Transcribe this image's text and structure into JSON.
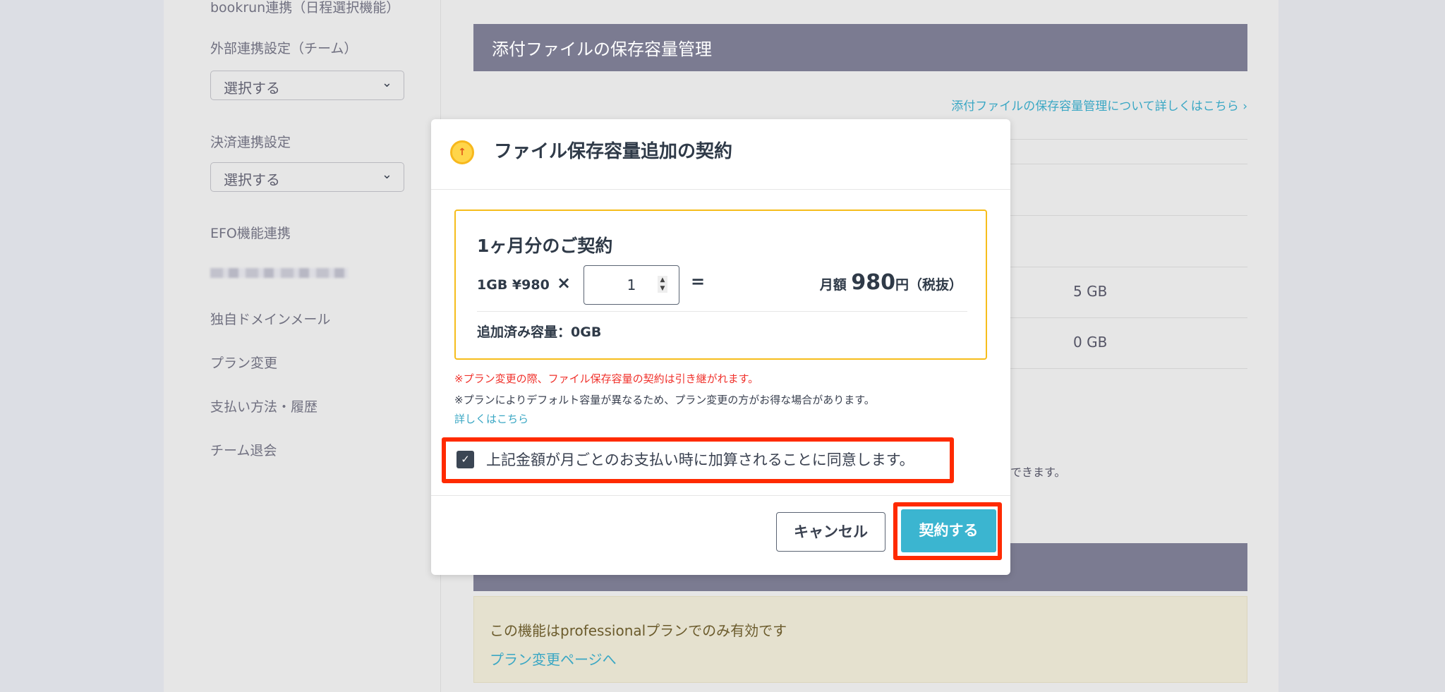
{
  "sidebar": {
    "bookrun": "bookrun連携（日程選択機能）",
    "external_label": "外部連携設定（チーム）",
    "external_select": "選択する",
    "payment_label": "決済連携設定",
    "payment_select": "選択する",
    "efo": "EFO機能連携",
    "domain_mail": "独自ドメインメール",
    "plan_change": "プラン変更",
    "payment_history": "支払い方法・履歴",
    "leave_team": "チーム退会"
  },
  "main": {
    "section_title": "添付ファイルの保存容量管理",
    "help_link": "添付ファイルの保存容量管理について詳しくはこちら",
    "rows": [
      {
        "value": "5 GB"
      },
      {
        "value": "0 GB"
      }
    ],
    "partial_text": "できます。",
    "notice_text": "この機能はprofessionalプランでのみ有効です",
    "notice_link": "プラン変更ページへ"
  },
  "modal": {
    "title": "ファイル保存容量追加の契約",
    "box_title": "1ヶ月分のご契約",
    "unit_price": "1GB ¥980",
    "times": "×",
    "quantity": "1",
    "equals": "=",
    "monthly_label": "月額",
    "monthly_amount": "980",
    "yen_tax": "円（税抜）",
    "added_capacity": "追加済み容量：0GB",
    "warning_note": "※プラン変更の際、ファイル保存容量の契約は引き継がれます。",
    "info_note": "※プランによりデフォルト容量が異なるため、プラン変更の方がお得な場合があります。",
    "details_link": "詳しくはこちら",
    "agree_label": "上記金額が月ごとのお支払い時に加算されることに同意します。",
    "agree_checked": true,
    "cancel_label": "キャンセル",
    "confirm_label": "契約する"
  },
  "colors": {
    "accent": "#3bb5d0",
    "highlight": "#ff2a00",
    "box_border": "#f6bd1c",
    "header_bar": "#7b7b91"
  }
}
